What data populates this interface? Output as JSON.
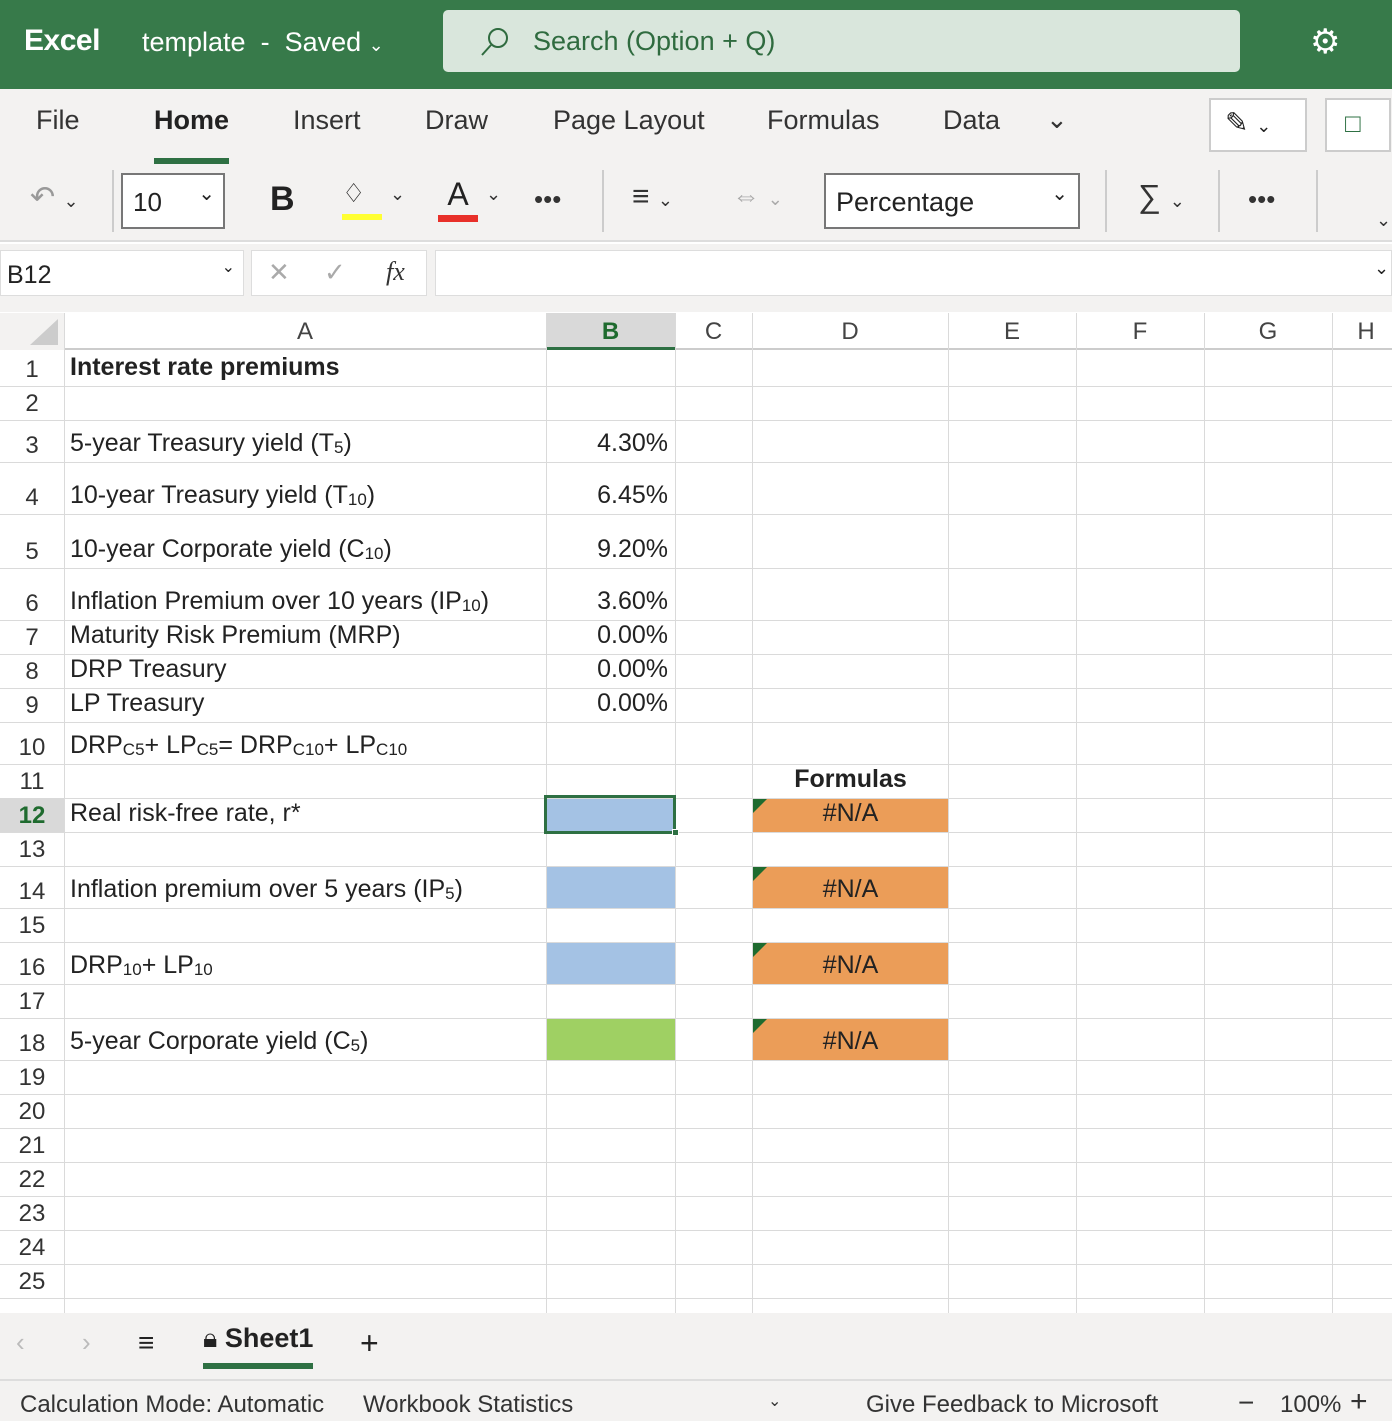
{
  "app": {
    "name": "Excel",
    "doc_title": "template",
    "doc_sep": "-",
    "doc_status": "Saved",
    "search_placeholder": "Search (Option + Q)"
  },
  "tabs": [
    "File",
    "Home",
    "Insert",
    "Draw",
    "Page Layout",
    "Formulas",
    "Data"
  ],
  "toolbar": {
    "font_size": "10",
    "bold": "B",
    "number_format": "Percentage",
    "highlight_color": "#ffff33",
    "font_color": "#e8302a"
  },
  "formula_bar": {
    "name_box": "B12",
    "fx": "fx",
    "value": ""
  },
  "columns": [
    "A",
    "B",
    "C",
    "D",
    "E",
    "F",
    "G",
    "H"
  ],
  "selected_cell": "B12",
  "rows": [
    {
      "n": "1",
      "a": [
        {
          "t": "Interest rate premiums"
        }
      ],
      "bold": true
    },
    {
      "n": "2",
      "a": []
    },
    {
      "n": "3",
      "a": [
        {
          "t": "5-year Treasury yield (T"
        },
        {
          "s": "5"
        },
        {
          "t": ")"
        }
      ],
      "b": "4.30%"
    },
    {
      "n": "4",
      "a": [
        {
          "t": "10-year Treasury yield (T"
        },
        {
          "s": "10"
        },
        {
          "t": ")"
        }
      ],
      "b": "6.45%"
    },
    {
      "n": "5",
      "a": [
        {
          "t": "10-year Corporate yield (C"
        },
        {
          "s": "10"
        },
        {
          "t": ")"
        }
      ],
      "b": "9.20%"
    },
    {
      "n": "6",
      "a": [
        {
          "t": "Inflation Premium over 10 years (IP"
        },
        {
          "s": "10"
        },
        {
          "t": ")"
        }
      ],
      "b": "3.60%"
    },
    {
      "n": "7",
      "a": [
        {
          "t": "Maturity Risk Premium (MRP)"
        }
      ],
      "b": "0.00%"
    },
    {
      "n": "8",
      "a": [
        {
          "t": "DRP Treasury"
        }
      ],
      "b": "0.00%"
    },
    {
      "n": "9",
      "a": [
        {
          "t": "LP Treasury"
        }
      ],
      "b": "0.00%"
    },
    {
      "n": "10",
      "a": [
        {
          "t": "DRP"
        },
        {
          "s": "C5"
        },
        {
          "t": " + LP"
        },
        {
          "s": "C5"
        },
        {
          "t": " = DRP"
        },
        {
          "s": "C10"
        },
        {
          "t": " + LP"
        },
        {
          "s": "C10"
        }
      ]
    },
    {
      "n": "11",
      "a": [],
      "d": "Formulas"
    },
    {
      "n": "12",
      "a": [
        {
          "t": "Real risk-free rate, r*"
        }
      ],
      "d": "#N/A",
      "fill": "#a4c2e4"
    },
    {
      "n": "13",
      "a": []
    },
    {
      "n": "14",
      "a": [
        {
          "t": "Inflation premium over 5 years (IP"
        },
        {
          "s": "5"
        },
        {
          "t": ")"
        }
      ],
      "d": "#N/A",
      "fill": "#a4c2e4"
    },
    {
      "n": "15",
      "a": []
    },
    {
      "n": "16",
      "a": [
        {
          "t": "DRP"
        },
        {
          "s": "10"
        },
        {
          "t": " + LP"
        },
        {
          "s": "10"
        }
      ],
      "d": "#N/A",
      "fill": "#a4c2e4"
    },
    {
      "n": "17",
      "a": []
    },
    {
      "n": "18",
      "a": [
        {
          "t": "5-year Corporate yield (C"
        },
        {
          "s": "5"
        },
        {
          "t": ")"
        }
      ],
      "d": "#N/A",
      "fill": "#9fd063"
    },
    {
      "n": "19",
      "a": []
    },
    {
      "n": "20",
      "a": []
    },
    {
      "n": "21",
      "a": []
    },
    {
      "n": "22",
      "a": []
    },
    {
      "n": "23",
      "a": []
    },
    {
      "n": "24",
      "a": []
    },
    {
      "n": "25",
      "a": []
    }
  ],
  "formula_cell_fill": "#eb9d58",
  "sheets": {
    "active": "Sheet1"
  },
  "status": {
    "calc": "Calculation Mode: Automatic",
    "stats": "Workbook Statistics",
    "feedback": "Give Feedback to Microsoft",
    "zoom": "100%"
  }
}
